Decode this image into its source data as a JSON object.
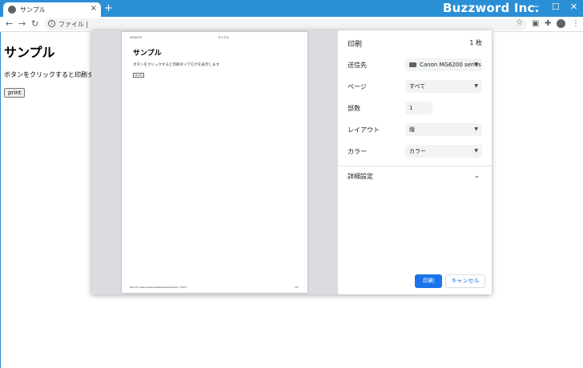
{
  "browser": {
    "tab_title": "サンプル",
    "tab_close": "×",
    "new_tab": "+",
    "brand": "Buzzword Inc.",
    "window_min": "─",
    "window_max": "☐",
    "window_close": "✕",
    "url_text": "ファイル  |",
    "icons": [
      "back-icon",
      "forward-icon",
      "reload-icon",
      "info-icon",
      "star-icon",
      "extension-icon",
      "puzzle-icon",
      "avatar-icon",
      "menu-icon"
    ]
  },
  "page": {
    "heading": "サンプル",
    "paragraph": "ボタンをクリックすると印刷ダ",
    "button_label": "print"
  },
  "preview": {
    "header_date": "2020/7/1",
    "header_title": "サンプル",
    "heading": "サンプル",
    "paragraph": "ボタンをクリックすると印刷ダイアログを表示します",
    "button_label": "print",
    "footer_url": "file:///C:/users/user/web/sample/sample_1.html",
    "footer_page": "1/1"
  },
  "print_panel": {
    "title": "印刷",
    "sheet_count": "1 枚",
    "destination_label": "送信先",
    "destination_value": "Canon MG6200 series",
    "pages_label": "ページ",
    "pages_value": "すべて",
    "copies_label": "部数",
    "copies_value": "1",
    "layout_label": "レイアウト",
    "layout_value": "縦",
    "color_label": "カラー",
    "color_value": "カラー",
    "more_settings_label": "詳細設定",
    "print_button": "印刷",
    "cancel_button": "キャンセル"
  },
  "colors": {
    "titlebar": "#2b8fd6",
    "accent": "#1a73e8"
  }
}
